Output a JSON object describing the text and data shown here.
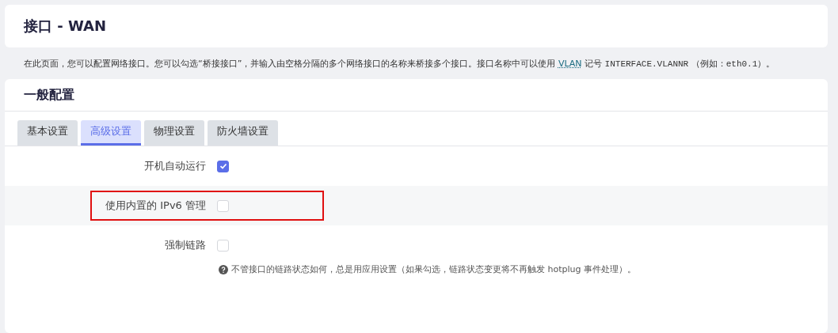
{
  "page_title": "接口 - WAN",
  "description": [
    {
      "kind": "text",
      "text": "在此页面，您可以配置网络接口。您可以勾选“桥接接口”，并输入由空格分隔的多个网络接口的名称来桥接多个接口。接口名称中可以使用 "
    },
    {
      "kind": "link",
      "text": "VLAN"
    },
    {
      "kind": "text",
      "text": " 记号 "
    },
    {
      "kind": "code",
      "text": "INTERFACE.VLANNR"
    },
    {
      "kind": "text",
      "text": " （例如："
    },
    {
      "kind": "code",
      "text": "eth0.1"
    },
    {
      "kind": "text",
      "text": "）。"
    }
  ],
  "section": {
    "title": "一般配置",
    "tabs": [
      {
        "label": "基本设置",
        "selected": false
      },
      {
        "label": "高级设置",
        "selected": true
      },
      {
        "label": "物理设置",
        "selected": false
      },
      {
        "label": "防火墙设置",
        "selected": false
      }
    ],
    "options": [
      {
        "label": "开机自动运行",
        "checked": true,
        "highlighted": false
      },
      {
        "label": "使用内置的 IPv6 管理",
        "checked": false,
        "highlighted": true
      },
      {
        "label": "强制链路",
        "checked": false,
        "highlighted": false,
        "help": "不管接口的链路状态如何，总是用应用设置（如果勾选，链路状态变更将不再触发 hotplug 事件处理）。"
      }
    ]
  }
}
